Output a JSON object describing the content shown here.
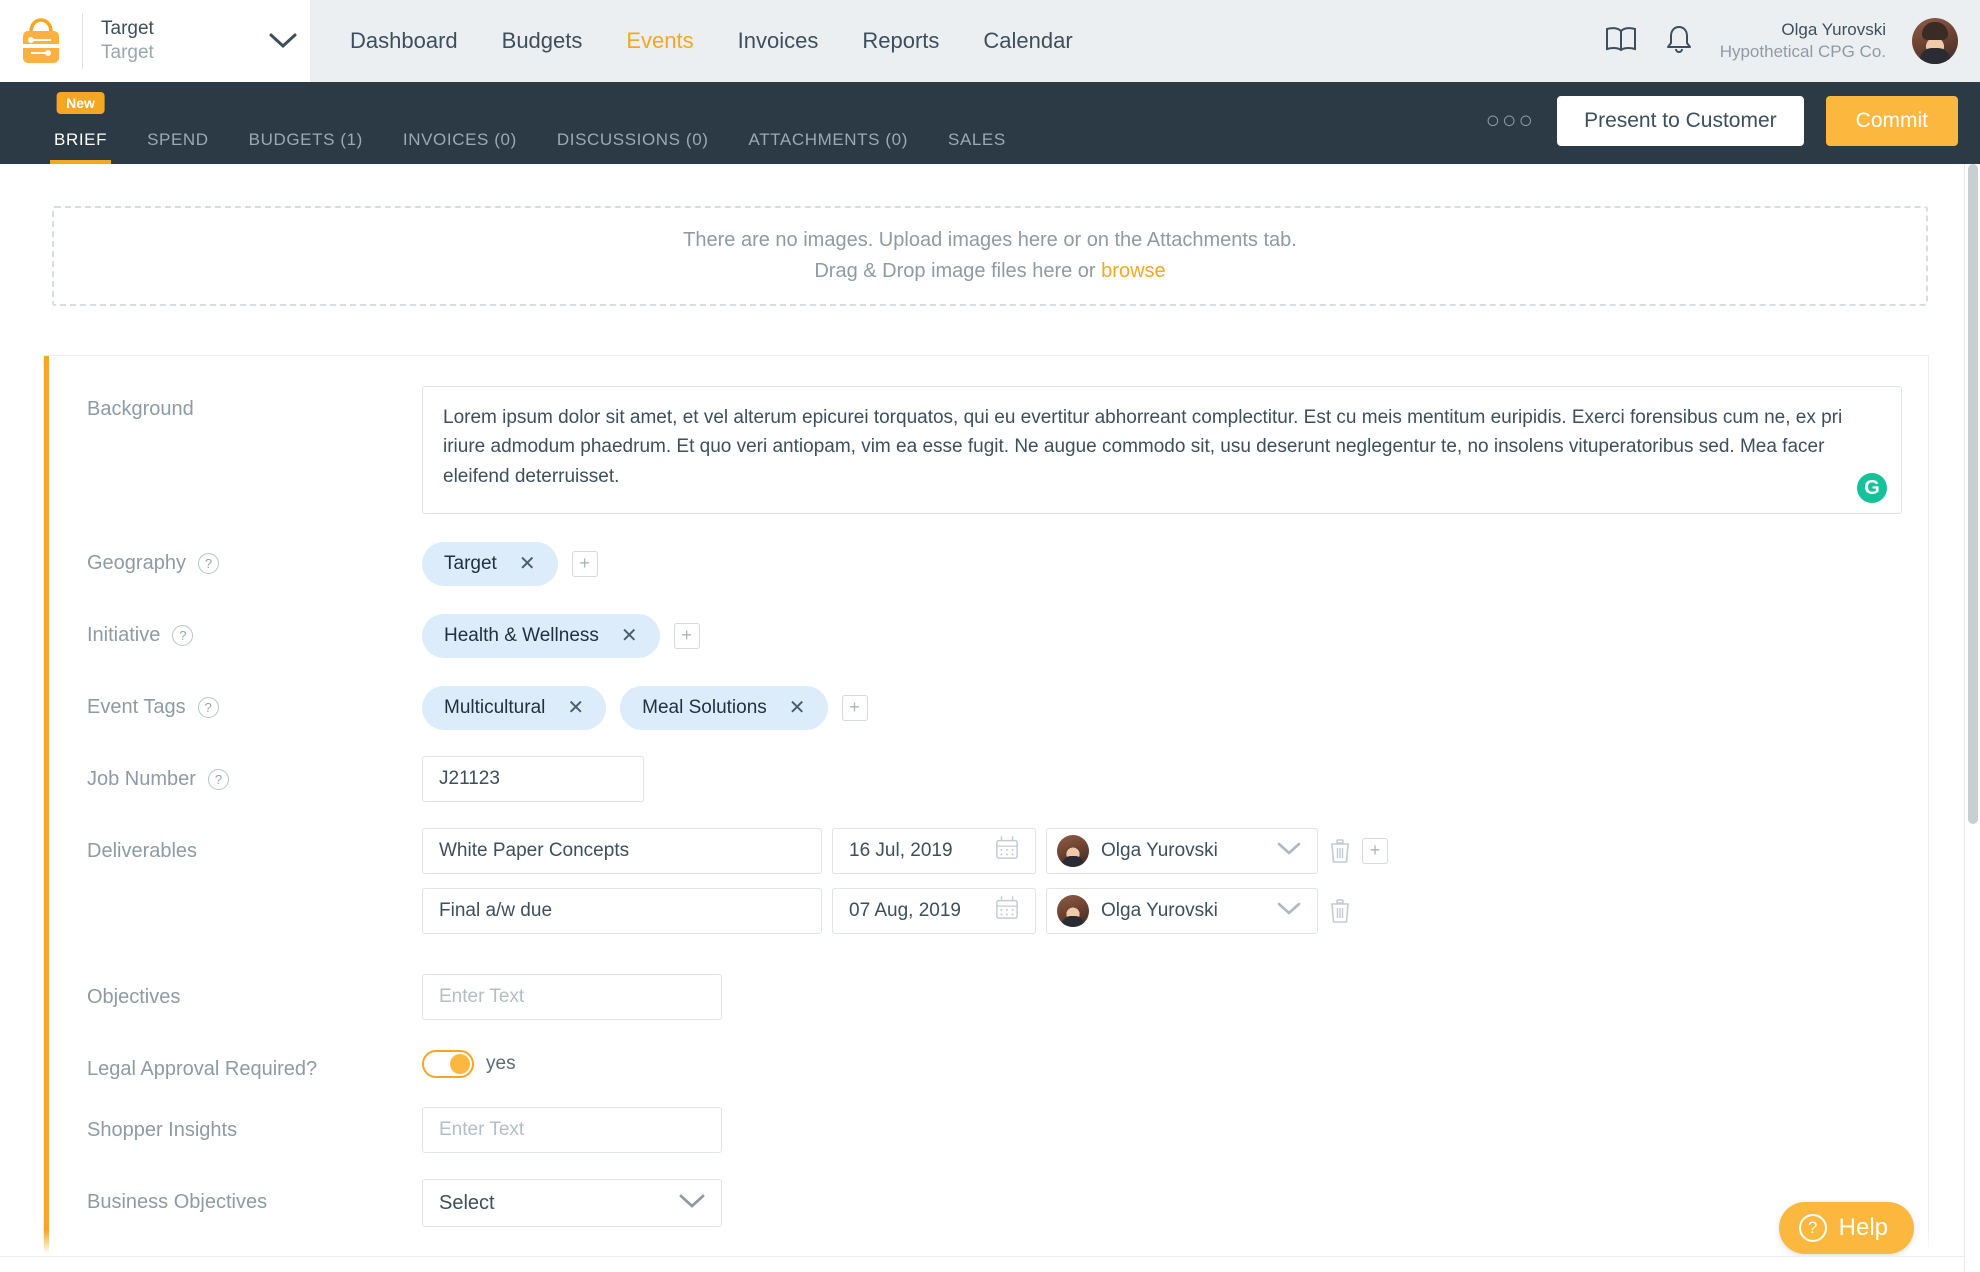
{
  "brand": {
    "logo_icon": "shopping-bag-icon",
    "name": "Target",
    "sub": "Target",
    "caret_icon": "chevron-down-icon"
  },
  "mainnav": {
    "items": [
      {
        "label": "Dashboard",
        "active": false
      },
      {
        "label": "Budgets",
        "active": false
      },
      {
        "label": "Events",
        "active": true
      },
      {
        "label": "Invoices",
        "active": false
      },
      {
        "label": "Reports",
        "active": false
      },
      {
        "label": "Calendar",
        "active": false
      }
    ],
    "book_icon": "book-icon",
    "bell_icon": "bell-icon"
  },
  "user": {
    "name": "Olga Yurovski",
    "org": "Hypothetical CPG Co.",
    "avatar_icon": "user-avatar"
  },
  "subnav": {
    "badge": "New",
    "tabs": [
      {
        "label": "BRIEF",
        "active": true
      },
      {
        "label": "SPEND",
        "active": false
      },
      {
        "label": "BUDGETS (1)",
        "active": false
      },
      {
        "label": "INVOICES (0)",
        "active": false
      },
      {
        "label": "DISCUSSIONS (0)",
        "active": false
      },
      {
        "label": "ATTACHMENTS (0)",
        "active": false
      },
      {
        "label": "SALES",
        "active": false
      }
    ],
    "overflow_icon": "more-options-icon",
    "present_label": "Present to Customer",
    "commit_label": "Commit"
  },
  "dropzone": {
    "line1": "There are no images. Upload images here or on the Attachments tab.",
    "line2_prefix": "Drag & Drop image files here or ",
    "browse_label": "browse"
  },
  "form": {
    "background": {
      "label": "Background",
      "value": "Lorem ipsum dolor sit amet, et vel alterum epicurei torquatos, qui eu evertitur abhorreant complectitur. Est cu meis mentitum euripidis. Exerci forensibus cum ne, ex pri iriure admodum phaedrum. Et quo veri antiopam, vim ea esse fugit. Ne augue commodo sit, usu deserunt neglegentur te, no insolens vituperatoribus sed. Mea facer eleifend deterruisset.",
      "grammarly_icon": "grammarly-icon",
      "grammarly_glyph": "G"
    },
    "geography": {
      "label": "Geography",
      "help_icon": "help-question-icon",
      "chips": [
        "Target"
      ],
      "add_icon": "plus-icon"
    },
    "initiative": {
      "label": "Initiative",
      "help_icon": "help-question-icon",
      "chips": [
        "Health & Wellness"
      ],
      "add_icon": "plus-icon"
    },
    "event_tags": {
      "label": "Event Tags",
      "help_icon": "help-question-icon",
      "chips": [
        "Multicultural",
        "Meal Solutions"
      ],
      "add_icon": "plus-icon"
    },
    "job_number": {
      "label": "Job Number",
      "help_icon": "help-question-icon",
      "value": "J21123"
    },
    "deliverables": {
      "label": "Deliverables",
      "rows": [
        {
          "name": "White Paper Concepts",
          "date": "16 Jul, 2019",
          "owner": "Olga Yurovski",
          "calendar_icon": "calendar-icon",
          "caret_icon": "chevron-down-icon",
          "delete_icon": "trash-icon",
          "add_icon": "plus-icon",
          "has_add": true
        },
        {
          "name": "Final a/w due",
          "date": "07 Aug, 2019",
          "owner": "Olga Yurovski",
          "calendar_icon": "calendar-icon",
          "caret_icon": "chevron-down-icon",
          "delete_icon": "trash-icon",
          "has_add": false
        }
      ]
    },
    "objectives": {
      "label": "Objectives",
      "placeholder": "Enter Text",
      "value": ""
    },
    "legal_approval": {
      "label": "Legal Approval Required?",
      "state": "yes",
      "on": true
    },
    "shopper_insights": {
      "label": "Shopper Insights",
      "placeholder": "Enter Text",
      "value": ""
    },
    "business_objectives": {
      "label": "Business Objectives",
      "selected": "Select",
      "caret_icon": "chevron-down-icon"
    }
  },
  "help": {
    "label": "Help",
    "icon": "help-question-icon"
  },
  "colors": {
    "accent_orange": "#f5a623",
    "commit_orange": "#fcb73e",
    "dark_nav": "#2c3a45",
    "chip_blue": "#dcecfa",
    "text_slate": "#3d4f5d",
    "muted": "#8e9ba4",
    "grammarly_green": "#15c39a"
  }
}
